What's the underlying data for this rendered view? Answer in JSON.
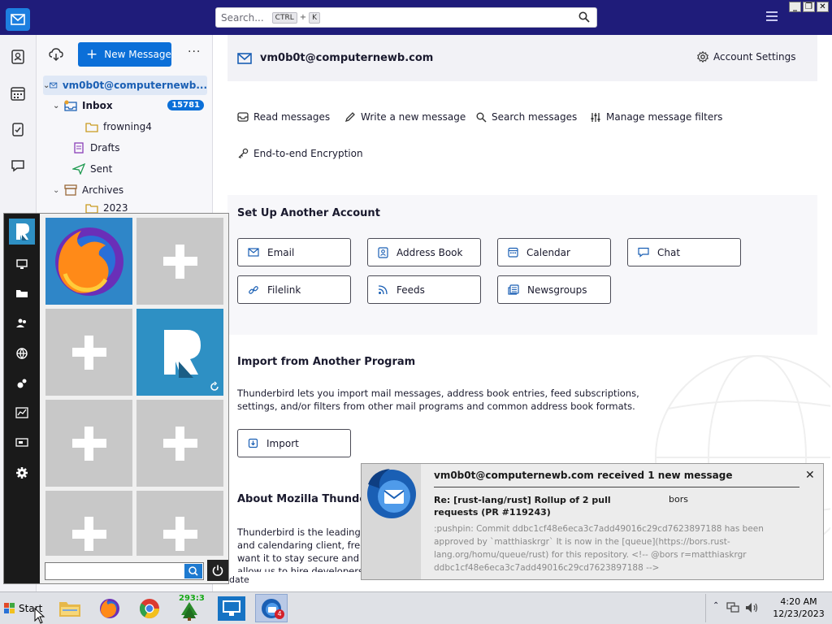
{
  "titlebar": {
    "search_placeholder": "Search...",
    "search_shortcut_key1": "CTRL",
    "search_shortcut_plus": "+",
    "search_shortcut_key2": "K"
  },
  "folderpane": {
    "new_message_label": "New Message",
    "more_label": "···",
    "account_name": "vm0b0t@computernewb...",
    "folders": {
      "inbox": "Inbox",
      "inbox_count": "15781",
      "frowning4": "frowning4",
      "drafts": "Drafts",
      "sent": "Sent",
      "archives": "Archives",
      "archives_2023": "2023"
    }
  },
  "main": {
    "account_title": "vm0b0t@computernewb.com",
    "account_settings": "Account Settings",
    "actions": {
      "read": "Read messages",
      "write": "Write a new message",
      "search": "Search messages",
      "filters": "Manage message filters",
      "e2e": "End-to-end Encryption"
    },
    "setup_title": "Set Up Another Account",
    "setup_buttons": {
      "email": "Email",
      "address_book": "Address Book",
      "calendar": "Calendar",
      "chat": "Chat",
      "filelink": "Filelink",
      "feeds": "Feeds",
      "newsgroups": "Newsgroups"
    },
    "import_title": "Import from Another Program",
    "import_text": "Thunderbird lets you import mail messages, address book entries, feed subscriptions, settings, and/or filters from other mail programs and common address book formats.",
    "import_button": "Import",
    "about_title": "About Mozilla Thunderbird",
    "about_text": "Thunderbird is the leading op and calendaring client, free fo want it to stay secure and be allow us to hire developers, p",
    "status_fragment": "date"
  },
  "notification": {
    "title": "vm0b0t@computernewb.com received 1 new message",
    "close": "✕",
    "subject": "Re: [rust-lang/rust] Rollup of 2 pull requests (PR #119243)",
    "from": "bors",
    "body": ":pushpin: Commit ddbc1cf48e6eca3c7add49016c29cd7623897188 has been approved by `matthiaskrgr` It is now in the [queue](https://bors.rust-lang.org/homu/queue/rust) for this repository. <!-- @bors r=matthiaskrgr ddbc1cf48e6eca3c7add49016c29cd7623897188 -->"
  },
  "taskbar": {
    "start_label": "Start",
    "green_counter": "293:3",
    "thunderbird_badge": "4",
    "clock_time": "4:20 AM",
    "clock_date": "12/23/2023"
  },
  "colors": {
    "titlebar": "#1f1c7a",
    "accent": "#0b6fd8",
    "start_menu_bar": "#1a1a1a",
    "tile_blue": "#2e90c4"
  }
}
